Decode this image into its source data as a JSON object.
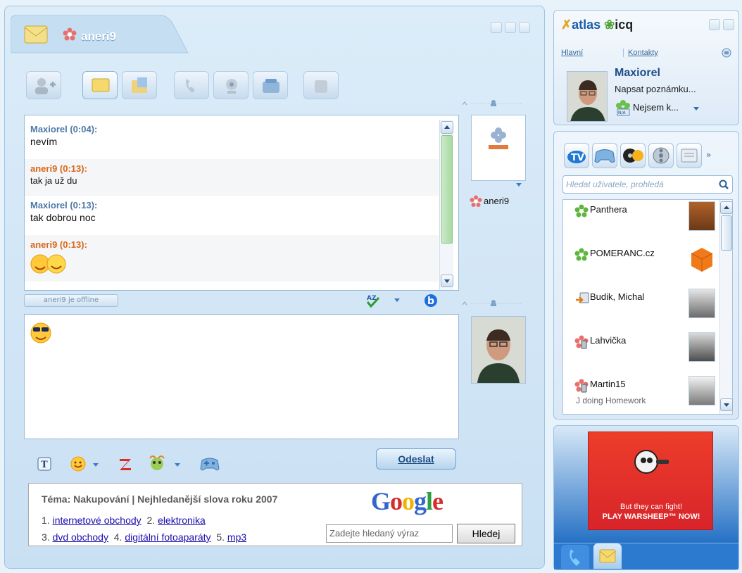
{
  "chat": {
    "contact_name": "aneri9",
    "messages": [
      {
        "sender": "Maxiorel (0:04):",
        "text": "nevím",
        "side": "self"
      },
      {
        "sender": "aneri9 (0:13):",
        "text": "tak ja už du",
        "side": "other"
      },
      {
        "sender": "Maxiorel (0:13):",
        "text": "tak dobrou noc",
        "side": "self"
      },
      {
        "sender": "aneri9 (0:13):",
        "text": "",
        "side": "other"
      }
    ],
    "status_badge": "aneri9 je offline",
    "send_label": "Odeslat",
    "partner_label": "aneri9"
  },
  "ad": {
    "topic": "Téma: Nakupování | Nejhledanější slova roku 2007",
    "links": [
      {
        "n": "1.",
        "label": "internetové obchody"
      },
      {
        "n": "2.",
        "label": "elektronika"
      },
      {
        "n": "3.",
        "label": "dvd obchody"
      },
      {
        "n": "4.",
        "label": "digitální fotoaparáty"
      },
      {
        "n": "5.",
        "label": "mp3"
      }
    ],
    "google_placeholder": "Zadejte hledaný výraz",
    "google_button": "Hledej",
    "google_logo": "Google"
  },
  "icq": {
    "brand_atlas": "atlas",
    "brand_icq": "icq",
    "nav_main": "Hlavní",
    "nav_contacts": "Kontakty",
    "user_name": "Maxiorel",
    "note_prompt": "Napsat poznámku...",
    "status": "Nejsem k...",
    "search_placeholder": "Hledat uživatele, prohledá",
    "contacts": [
      {
        "name": "Panthera",
        "status": "",
        "icon": "flower-online-icon"
      },
      {
        "name": "POMERANC.cz",
        "status": "",
        "icon": "flower-online-icon"
      },
      {
        "name": "Budik, Michal",
        "status": "",
        "icon": "msn-contact-icon"
      },
      {
        "name": "Lahvička",
        "status": "",
        "icon": "flower-mobile-icon"
      },
      {
        "name": "Martin15",
        "status": "J doing Homework",
        "icon": "flower-mobile-icon"
      }
    ],
    "banner_line1": "But they can fight!",
    "banner_line2": "PLAY WARSHEEP™ NOW!"
  },
  "colors": {
    "accent": "#4f78a8",
    "other_sender": "#d9671a",
    "link": "#1a0dab"
  }
}
